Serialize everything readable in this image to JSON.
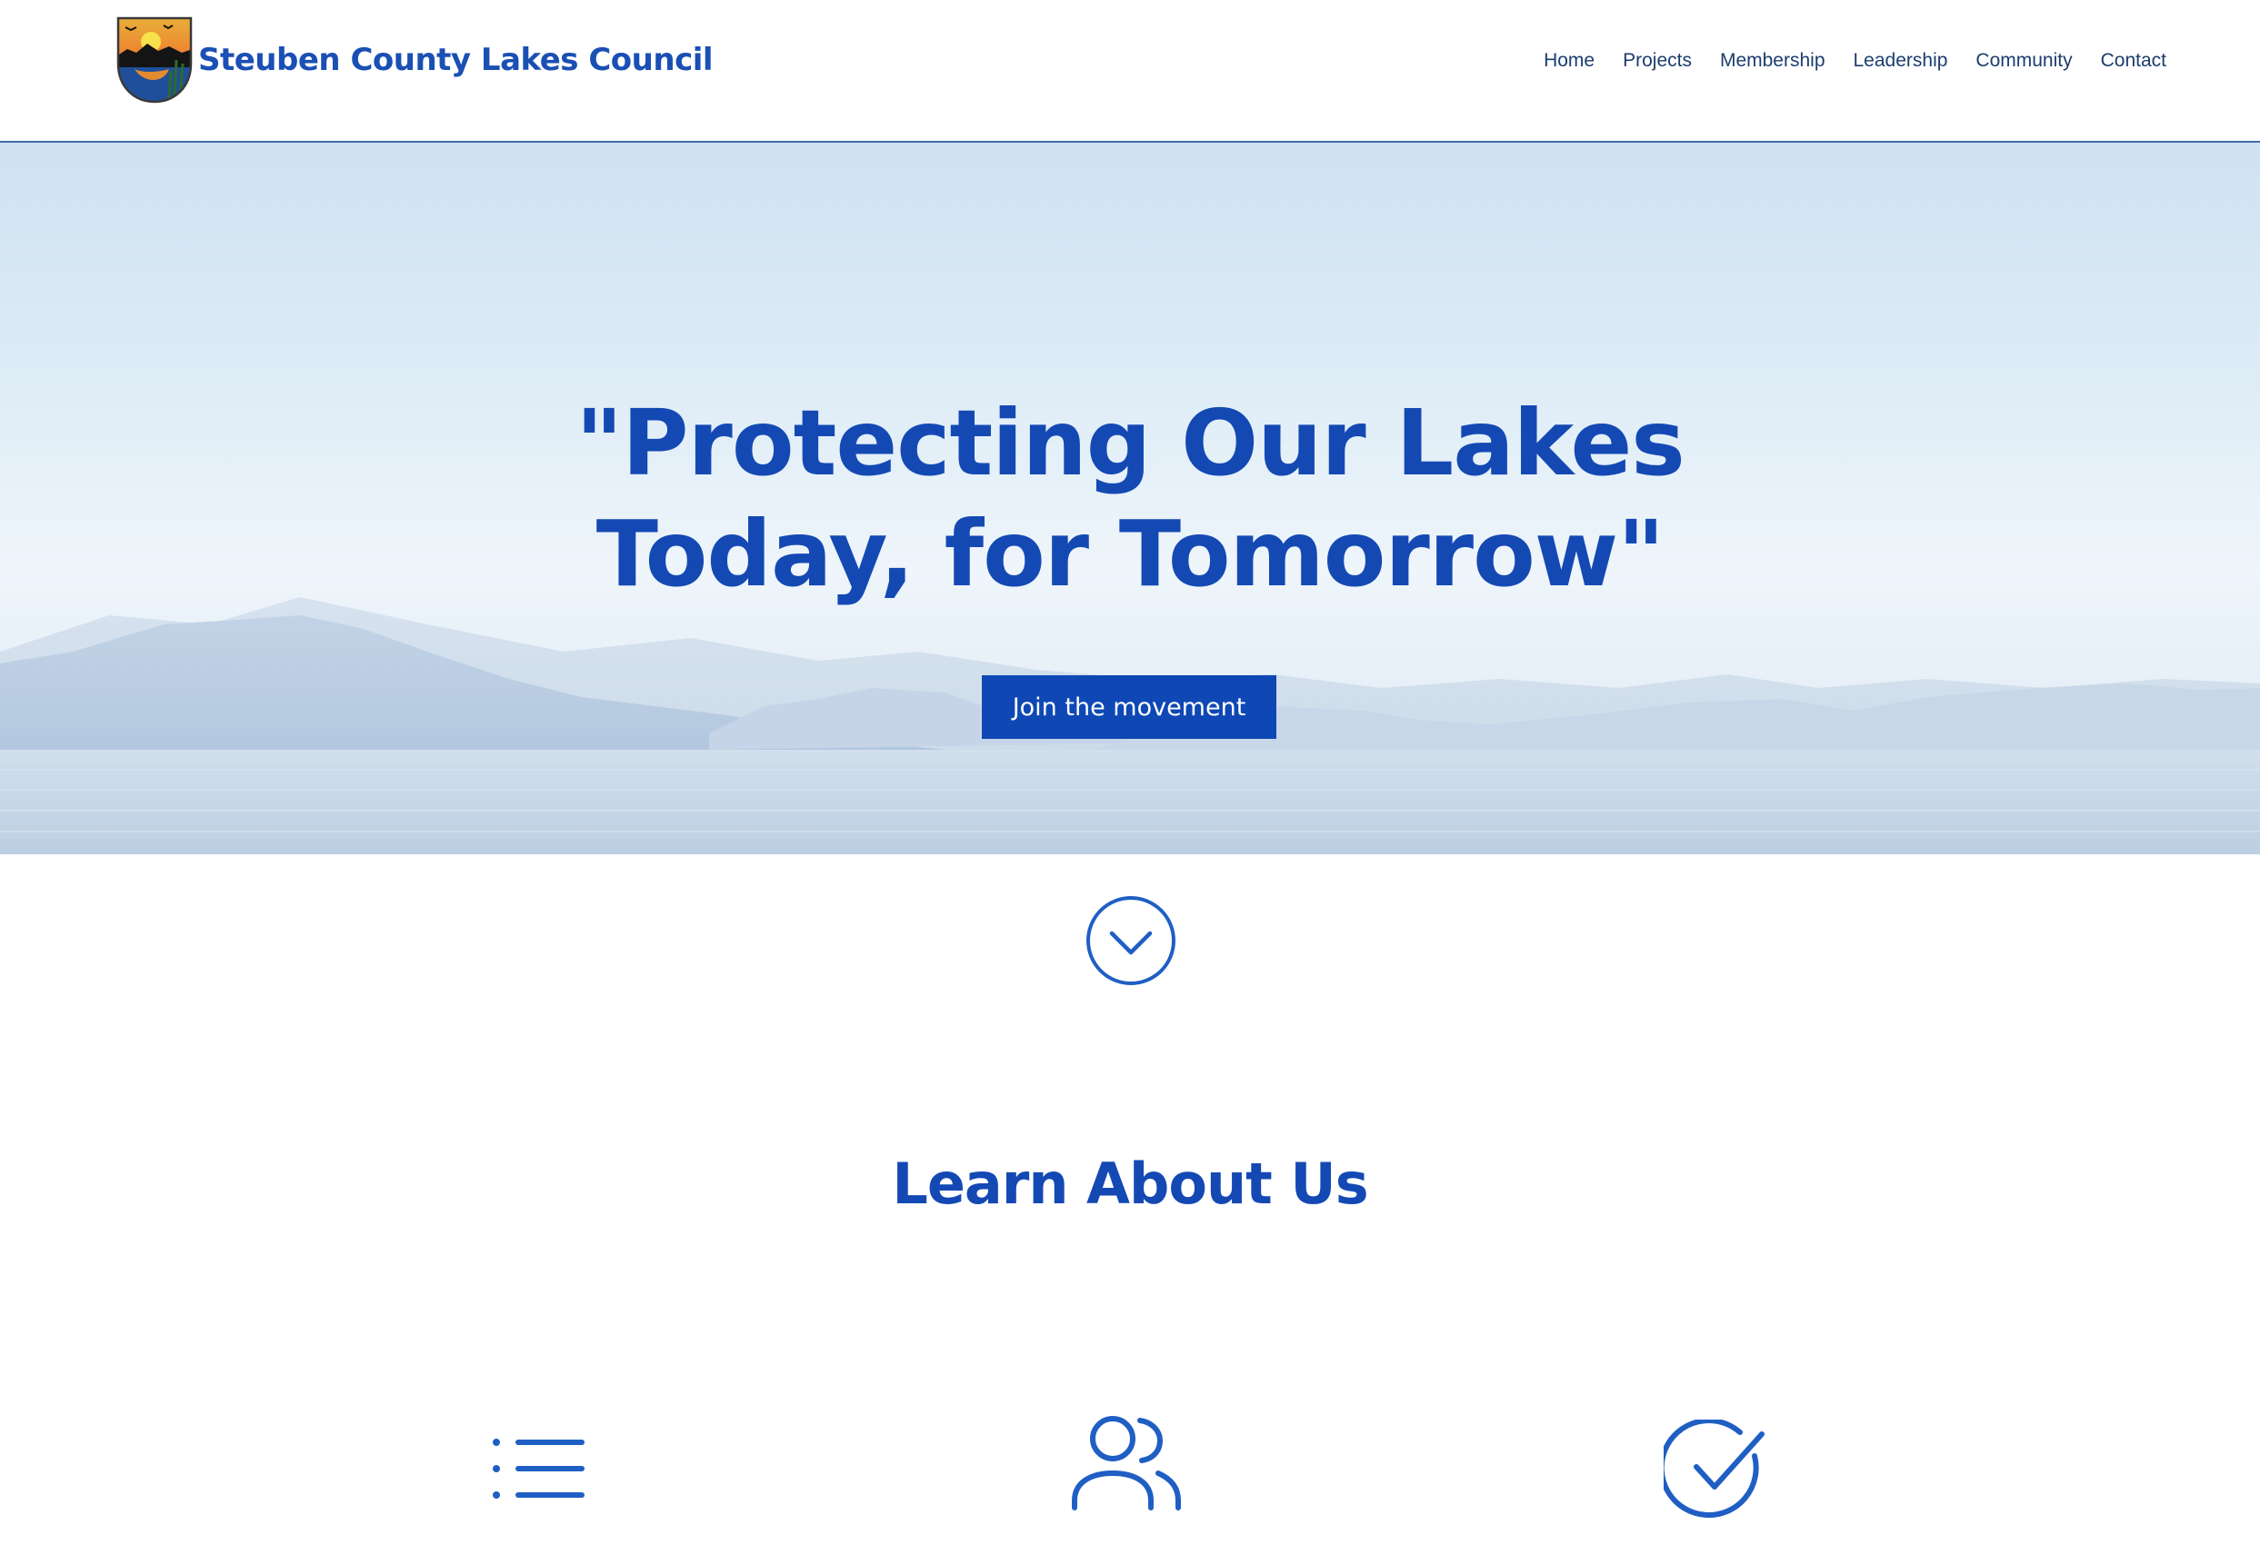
{
  "header": {
    "brand_name": "Steuben County Lakes Council",
    "logo_icon": "county-shield-logo",
    "nav": [
      {
        "label": "Home"
      },
      {
        "label": "Projects"
      },
      {
        "label": "Membership"
      },
      {
        "label": "Leadership"
      },
      {
        "label": "Community"
      },
      {
        "label": "Contact"
      }
    ]
  },
  "hero": {
    "title_line_1": "\"Protecting Our Lakes",
    "title_line_2": "Today, for Tomorrow\"",
    "cta_label": "Join the movement"
  },
  "scroll": {
    "icon": "chevron-down-circle-icon"
  },
  "learn": {
    "title": "Learn About Us",
    "features": [
      {
        "icon": "list-icon"
      },
      {
        "icon": "users-icon"
      },
      {
        "icon": "check-circle-icon"
      }
    ]
  },
  "colors": {
    "brand_blue": "#1449b4",
    "button_blue": "#0f48b5",
    "nav_text": "#1c3d6e",
    "icon_blue": "#1f5fc4",
    "header_border": "#3f6aa8"
  }
}
